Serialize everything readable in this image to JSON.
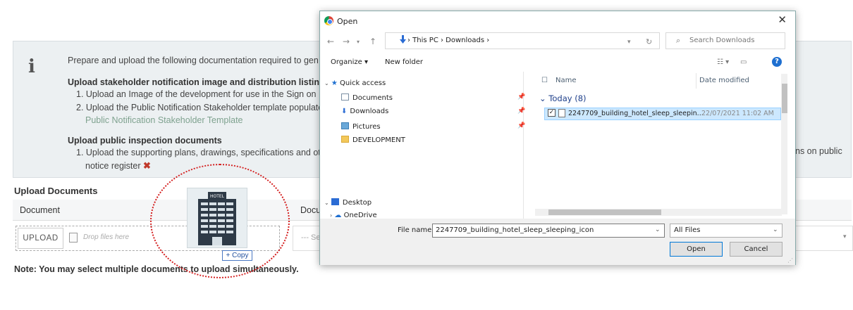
{
  "page": {
    "info_lines": [
      "Prepare and upload the following documentation required to gen",
      "Upload stakeholder notification image and distribution listin",
      "1. Upload an Image of the development for use in the Sign on L",
      "2. Upload the Public Notification Stakeholder template populate",
      "Public Notification Stakeholder Template",
      "Upload public inspection documents",
      "1. Upload the supporting plans, drawings, specifications and ot",
      "notice register"
    ],
    "info_tail": "ns on public",
    "upload_title": "Upload Documents",
    "columns": [
      "Document",
      "Docu"
    ],
    "upload_button": "UPLOAD",
    "drop_placeholder": "Drop files here",
    "select_placeholder": "--- Se",
    "note": "Note: You may select multiple documents to upload simultaneously.",
    "copy_badge": "+ Copy",
    "thumb_label": "HOTEL"
  },
  "dialog": {
    "title": "Open",
    "close_glyph": "✕",
    "address": "› This PC › Downloads ›",
    "search_placeholder": "Search Downloads",
    "organize": "Organize ▾",
    "new_folder": "New folder",
    "nav_items": [
      "Quick access",
      "Documents",
      "Downloads",
      "Pictures",
      "DEVELOPMENT",
      "Desktop",
      "OneDrive"
    ],
    "col_name": "Name",
    "col_date": "Date modified",
    "group": "Today (8)",
    "file_name": "2247709_building_hotel_sleep_sleepin...",
    "file_date": "22/07/2021 11:02 AM",
    "file_name_label": "File name:",
    "file_name_value": "2247709_building_hotel_sleep_sleeping_icon",
    "file_type": "All Files",
    "open_button": "Open",
    "cancel_button": "Cancel"
  }
}
